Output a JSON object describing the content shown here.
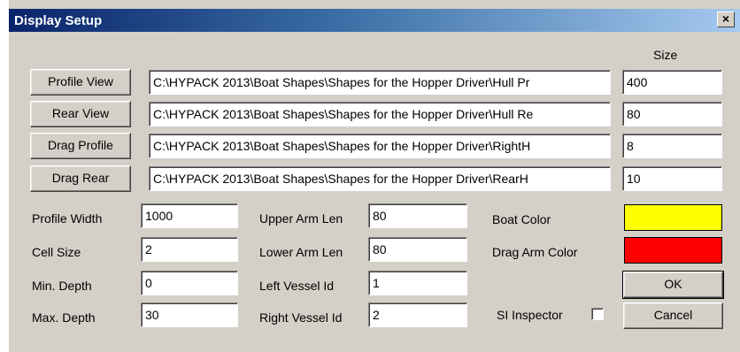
{
  "window": {
    "title": "Display Setup",
    "close_symbol": "×"
  },
  "size_header": "Size",
  "rows": [
    {
      "button": "Profile View",
      "path": "C:\\HYPACK 2013\\Boat Shapes\\Shapes for the Hopper Driver\\Hull Pr",
      "size": "400"
    },
    {
      "button": "Rear View",
      "path": "C:\\HYPACK 2013\\Boat Shapes\\Shapes for the Hopper Driver\\Hull Re",
      "size": "80"
    },
    {
      "button": "Drag Profile",
      "path": "C:\\HYPACK 2013\\Boat Shapes\\Shapes for the Hopper Driver\\RightH",
      "size": "8"
    },
    {
      "button": "Drag Rear",
      "path": "C:\\HYPACK 2013\\Boat Shapes\\Shapes for the Hopper Driver\\RearH",
      "size": "10"
    }
  ],
  "left_fields": [
    {
      "label": "Profile Width",
      "value": "1000"
    },
    {
      "label": "Cell Size",
      "value": "2"
    },
    {
      "label": "Min. Depth",
      "value": "0"
    },
    {
      "label": "Max. Depth",
      "value": "30"
    }
  ],
  "mid_fields": [
    {
      "label": "Upper Arm Len",
      "value": "80"
    },
    {
      "label": "Lower Arm Len",
      "value": "80"
    },
    {
      "label": "Left Vessel Id",
      "value": "1"
    },
    {
      "label": "Right Vessel Id",
      "value": "2"
    }
  ],
  "colors": {
    "boat_label": "Boat Color",
    "boat_color": "#ffff00",
    "drag_label": "Drag Arm Color",
    "drag_color": "#ff0000"
  },
  "si_inspector": {
    "label": "SI Inspector",
    "checked": false
  },
  "buttons": {
    "ok": "OK",
    "cancel": "Cancel"
  }
}
